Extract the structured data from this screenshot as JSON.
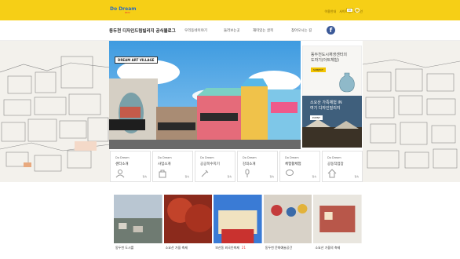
{
  "header": {
    "logo_text": "Do Dream",
    "logo_sub": "DDV",
    "top_links": [
      "이용안내",
      "사이트맵",
      "로그인"
    ],
    "lang": "KR"
  },
  "nav": {
    "title": "동두천 디자인드림빌리지 공식블로그",
    "items": [
      "우리동네이야기",
      "둘러보는곳",
      "재미있는 골목",
      "찾아오시는 길"
    ]
  },
  "hero": {
    "tag": "DREAM ART VILLAGE"
  },
  "side": {
    "top_title": "동두천도시재생센터의\n도자기(아트체험)",
    "top_badge": "SUBJECT",
    "bottom_title": "소요산 가족체험 IN\n여기 디자인빌리지",
    "bottom_badge": "EVENT"
  },
  "categories": [
    {
      "kicker": "Do Dream",
      "name": "센터소개"
    },
    {
      "kicker": "Do Dream",
      "name": "사업소개"
    },
    {
      "kicker": "Do Dream",
      "name": "공공목수지기"
    },
    {
      "kicker": "Do Dream",
      "name": "강의소개"
    },
    {
      "kicker": "Do Dream",
      "name": "체험활체험"
    },
    {
      "kicker": "Do Dream",
      "name": "공동작업장"
    }
  ],
  "category_go": "접속",
  "posts": [
    {
      "caption": "동두천 도시를"
    },
    {
      "caption": "소요산 가을 축제"
    },
    {
      "caption": "보산동 외국인축제",
      "count": "21"
    },
    {
      "caption": "동두천 문화예술공간"
    },
    {
      "caption": "소요산 가을의 축제"
    }
  ],
  "colors": {
    "brand_yellow": "#f6cf16",
    "facebook_blue": "#3b5998"
  }
}
